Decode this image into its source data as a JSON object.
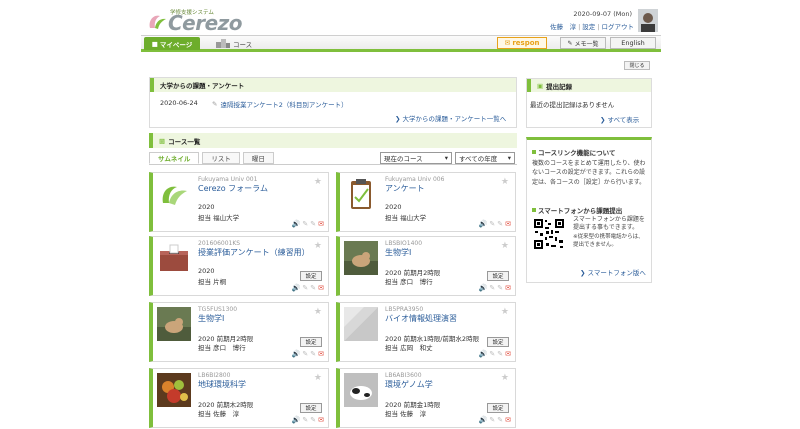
{
  "header": {
    "logo_subtitle": "学修支援システム",
    "logo_text": "Cerezo",
    "datetime": "2020-09-07 (Mon)",
    "user_name": "佐藤　淳",
    "settings_label": "設定",
    "logout_label": "ログアウト"
  },
  "nav": {
    "mypage_label": "マイページ",
    "course_label": "コース",
    "respon_label": "respon",
    "memo_label": "メモ一覧",
    "english_label": "English",
    "close_label": "閉じる"
  },
  "assignments": {
    "heading": "大学からの課題・アンケート",
    "items": [
      {
        "date": "2020-06-24",
        "label": "遠隔授業アンケート2（科目別アンケート）"
      }
    ],
    "more_label": "大学からの課題・アンケート一覧へ"
  },
  "courses": {
    "heading": "コース一覧",
    "tabs": [
      "サムネイル",
      "リスト",
      "曜日"
    ],
    "select_course": "現在のコース",
    "select_year": "すべての年度",
    "set_label": "設定",
    "cards": [
      {
        "code": "Fukuyama Univ 001",
        "title": "Cerezo フォーラム",
        "year": "2020",
        "teacher": "担当  福山大学",
        "thumb": "cerezo-logo",
        "has_set": false
      },
      {
        "code": "Fukuyama Univ 006",
        "title": "アンケート",
        "year": "2020",
        "teacher": "担当  福山大学",
        "thumb": "clipboard",
        "has_set": false
      },
      {
        "code": "201606001KS",
        "title": "授業評価アンケート（練習用）",
        "year": "2020",
        "teacher": "担当  片桐",
        "thumb": "ballot-box",
        "has_set": true
      },
      {
        "code": "LBSBIO1400",
        "title": "生物学Ⅰ",
        "year": "2020  前期月2時限",
        "teacher": "担当  彦口　博行",
        "thumb": "photo-cat",
        "has_set": true
      },
      {
        "code": "TG5FUS1300",
        "title": "生物学Ⅰ",
        "year": "2020  前期月2時限",
        "teacher": "担当  彦口　博行",
        "thumb": "photo-cat",
        "has_set": true
      },
      {
        "code": "LB5PRA3950",
        "title": "バイオ情報処理演習",
        "year": "2020  前期水1時限/前期水2時限",
        "teacher": "担当  広岡　和丈",
        "thumb": "abstract-gray",
        "has_set": true
      },
      {
        "code": "LB6BI2800",
        "title": "地球環境科学",
        "year": "2020  前期木2時限",
        "teacher": "担当  佐藤　淳",
        "thumb": "photo-food",
        "has_set": true
      },
      {
        "code": "LB6ABI3600",
        "title": "環境ゲノム学",
        "year": "2020  前期金1時限",
        "teacher": "担当  佐藤　淳",
        "thumb": "photo-animal",
        "has_set": true
      }
    ]
  },
  "records": {
    "heading": "提出記録",
    "text": "最近の提出記録はありません",
    "all_label": "すべて表示"
  },
  "info": {
    "link_heading": "コースリンク機能について",
    "link_text": "複数のコースをまとめて運用したり、使わないコースの設定ができます。これらの設定は、各コースの［設定］から行います。",
    "phone_heading": "スマートフォンから課題提出",
    "phone_text": "スマートフォンから課題を提出する事もできます。",
    "phone_note": "※従来型の携帯電話からは、提出できません。",
    "phone_link": "スマートフォン版へ"
  },
  "colors": {
    "accent_green": "#7fbf3c",
    "tab_green": "#6dad2b",
    "link_blue": "#2b5d9a",
    "respon_orange": "#e8a21a"
  }
}
